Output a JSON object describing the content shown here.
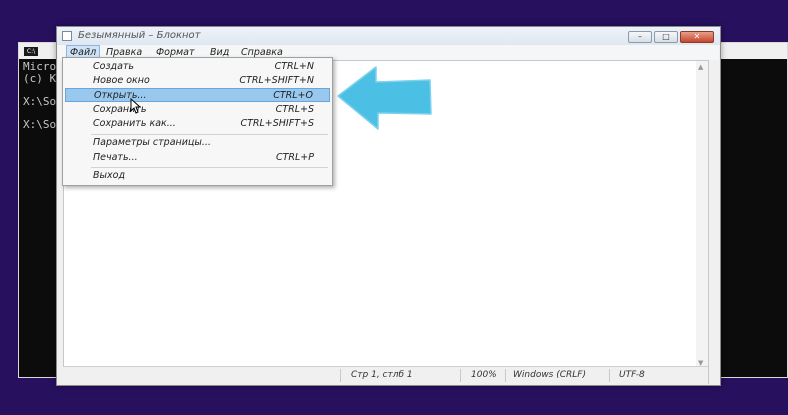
{
  "console": {
    "lines": [
      "Micro",
      "(c) K",
      "",
      "X:\\So",
      "",
      "X:\\So"
    ]
  },
  "notepad": {
    "title": "Безымянный – Блокнот",
    "menu": [
      {
        "label": "Файл",
        "active": true
      },
      {
        "label": "Правка"
      },
      {
        "label": "Формат"
      },
      {
        "label": "Вид"
      },
      {
        "label": "Справка"
      }
    ],
    "file_menu": {
      "group1": [
        {
          "label": "Создать",
          "shortcut": "CTRL+N"
        },
        {
          "label": "Новое окно",
          "shortcut": "CTRL+SHIFT+N"
        },
        {
          "label": "Открыть...",
          "shortcut": "CTRL+O",
          "highlighted": true
        },
        {
          "label": "Сохранить",
          "shortcut": "CTRL+S"
        },
        {
          "label": "Сохранить как...",
          "shortcut": "CTRL+SHIFT+S"
        }
      ],
      "group2": [
        {
          "label": "Параметры страницы...",
          "shortcut": ""
        },
        {
          "label": "Печать...",
          "shortcut": "CTRL+P"
        }
      ],
      "group3": [
        {
          "label": "Выход",
          "shortcut": ""
        }
      ]
    },
    "status": {
      "position": "Стр 1, стлб 1",
      "zoom": "100%",
      "line_ending": "Windows (CRLF)",
      "encoding": "UTF-8"
    }
  },
  "colors": {
    "desktop": "#27105e",
    "highlight": "#99c8ef",
    "arrow": "#4cc0e4"
  }
}
